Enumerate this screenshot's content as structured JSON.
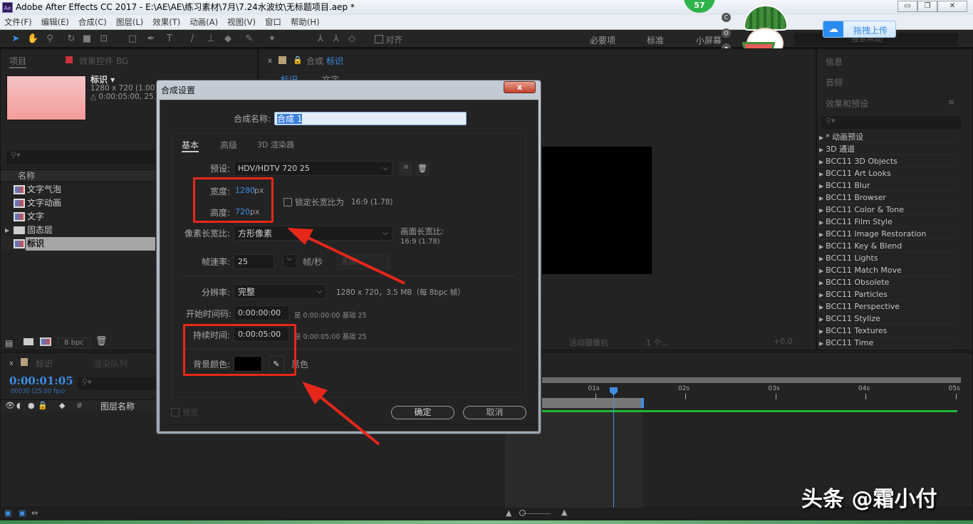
{
  "title_bar": {
    "app_icon": "Ae",
    "title": "Adobe After Effects CC 2017 - E:\\AE\\AE\\练习素材\\7月\\7.24水波纹\\无标题项目.aep *",
    "badge": "57",
    "upload_label": "拖拽上传"
  },
  "menu": [
    "文件(F)",
    "编辑(E)",
    "合成(C)",
    "图层(L)",
    "效果(T)",
    "动画(A)",
    "视图(V)",
    "窗口",
    "帮助(H)"
  ],
  "toolbar": {
    "snap_label": "对齐",
    "workspaces": [
      "必要项",
      "标准",
      "小屏幕"
    ],
    "search_help": "搜索帮助"
  },
  "project_panel": {
    "tab_project": "项目",
    "tab_effects": "效果控件 BG",
    "comp_name": "标识 ▾",
    "comp_size": "1280 x 720 (1.00)",
    "comp_duration": "△ 0:00:05:00, 25.",
    "column_name": "名称",
    "items": [
      {
        "label": "文字气泡",
        "type": "comp"
      },
      {
        "label": "文字动画",
        "type": "comp"
      },
      {
        "label": "文字",
        "type": "comp"
      },
      {
        "label": "固态层",
        "type": "folder"
      },
      {
        "label": "标识",
        "type": "comp",
        "selected": true
      }
    ],
    "bpc": "8 bpc"
  },
  "comp_panel": {
    "tab_prefix": "合成",
    "tab_name": "标识",
    "sub_tabs": [
      "标识",
      "文字"
    ],
    "camera": "活动摄像机",
    "views": "1 个...",
    "exposure": "+0.0"
  },
  "right_panel": {
    "info": "信息",
    "audio": "音频",
    "effects_presets": "效果和预设",
    "items": [
      "* 动画预设",
      "3D 通道",
      "BCC11 3D Objects",
      "BCC11 Art Looks",
      "BCC11 Blur",
      "BCC11 Browser",
      "BCC11 Color & Tone",
      "BCC11 Film Style",
      "BCC11 Image Restoration",
      "BCC11 Key & Blend",
      "BCC11 Lights",
      "BCC11 Match Move",
      "BCC11 Obsolete",
      "BCC11 Particles",
      "BCC11 Perspective",
      "BCC11 Stylize",
      "BCC11 Textures",
      "BCC11 Time"
    ]
  },
  "timeline": {
    "tab": "标识",
    "render_queue": "渲染队列",
    "timecode": "0:00:01:05",
    "frames": "00030 (25.00 fps)",
    "layer_name_col": "图层名称",
    "ticks": [
      "01s",
      "02s",
      "03s",
      "04s",
      "05s"
    ],
    "current_time_s": 1.2,
    "work_area_end_s": 5
  },
  "dialog": {
    "title": "合成设置",
    "close": "x",
    "name_label": "合成名称:",
    "name_value": "合成 1",
    "tabs": [
      "基本",
      "高级",
      "3D 渲染器"
    ],
    "preset_label": "预设:",
    "preset_value": "HDV/HDTV 720 25",
    "width_label": "宽度:",
    "width_value": "1280",
    "height_label": "高度:",
    "height_value": "720",
    "unit": "px",
    "lock_label": "锁定长宽比为",
    "lock_ratio": "16:9 (1.78)",
    "lock_checked": false,
    "par_label": "像素长宽比:",
    "par_value": "方形像素",
    "frame_ar_label": "画面长宽比:",
    "frame_ar_value": "16:9 (1.78)",
    "fps_label": "帧速率:",
    "fps_value": "25",
    "fps_unit": "帧/秒",
    "drop_frame": "丢帧",
    "res_label": "分辨率:",
    "res_value": "完整",
    "res_info": "1280 x 720，3.5 MB（每 8bpc 帧）",
    "start_label": "开始时间码:",
    "start_value": "0:00:00:00",
    "start_info": "是 0:00:00:00  基础 25",
    "dur_label": "持续时间:",
    "dur_value": "0:00:05:00",
    "dur_info": "是 0:00:05:00  基础 25",
    "bg_label": "背景颜色:",
    "bg_color": "#000000",
    "bg_name": "黑色",
    "preview": "预览",
    "ok": "确定",
    "cancel": "取消"
  },
  "watermark": "头条 @霜小付"
}
